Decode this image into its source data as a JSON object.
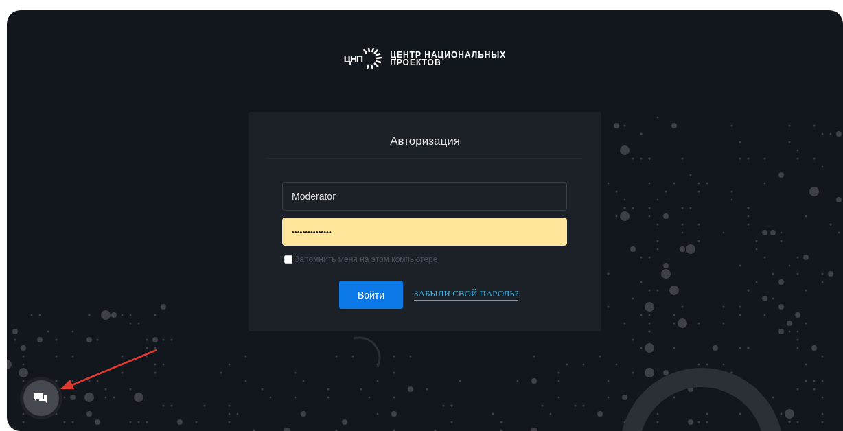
{
  "logo": {
    "mark": "ЦНП",
    "line_1": "ЦЕНТР НАЦИОНАЛЬНЫХ",
    "line_2": "ПРОЕКТОВ"
  },
  "login_form": {
    "title": "Авторизация",
    "username": {
      "value": "Moderator"
    },
    "password": {
      "value": "•••••••••••••••",
      "autofilled": true
    },
    "remember": {
      "label": "Запомнить меня на этом компьютере",
      "checked": false
    },
    "submit_button": "Войти",
    "forgot_link": "ЗАБЫЛИ СВОЙ ПАРОЛЬ?"
  }
}
